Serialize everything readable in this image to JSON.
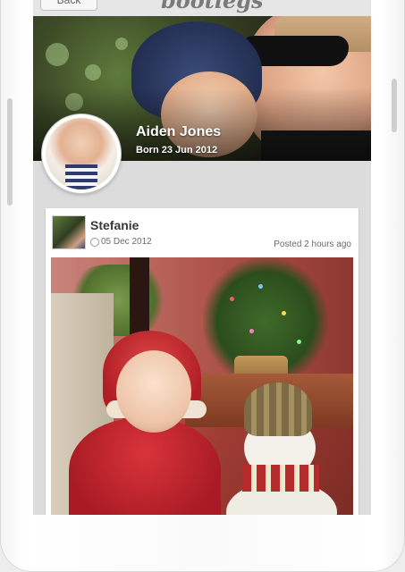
{
  "topbar": {
    "back_label": "Back",
    "logo_text": "bootlegs"
  },
  "profile": {
    "name": "Aiden Jones",
    "born": "Born 23 Jun 2012"
  },
  "post": {
    "author": "Stefanie",
    "date": "05 Dec 2012",
    "posted": "Posted 2 hours ago"
  },
  "icons": {
    "clock": "clock-icon"
  },
  "colors": {
    "text_dark": "#3a3a3a",
    "text_meta": "#6a6a6a",
    "screen_bg": "#dcdcdc"
  }
}
